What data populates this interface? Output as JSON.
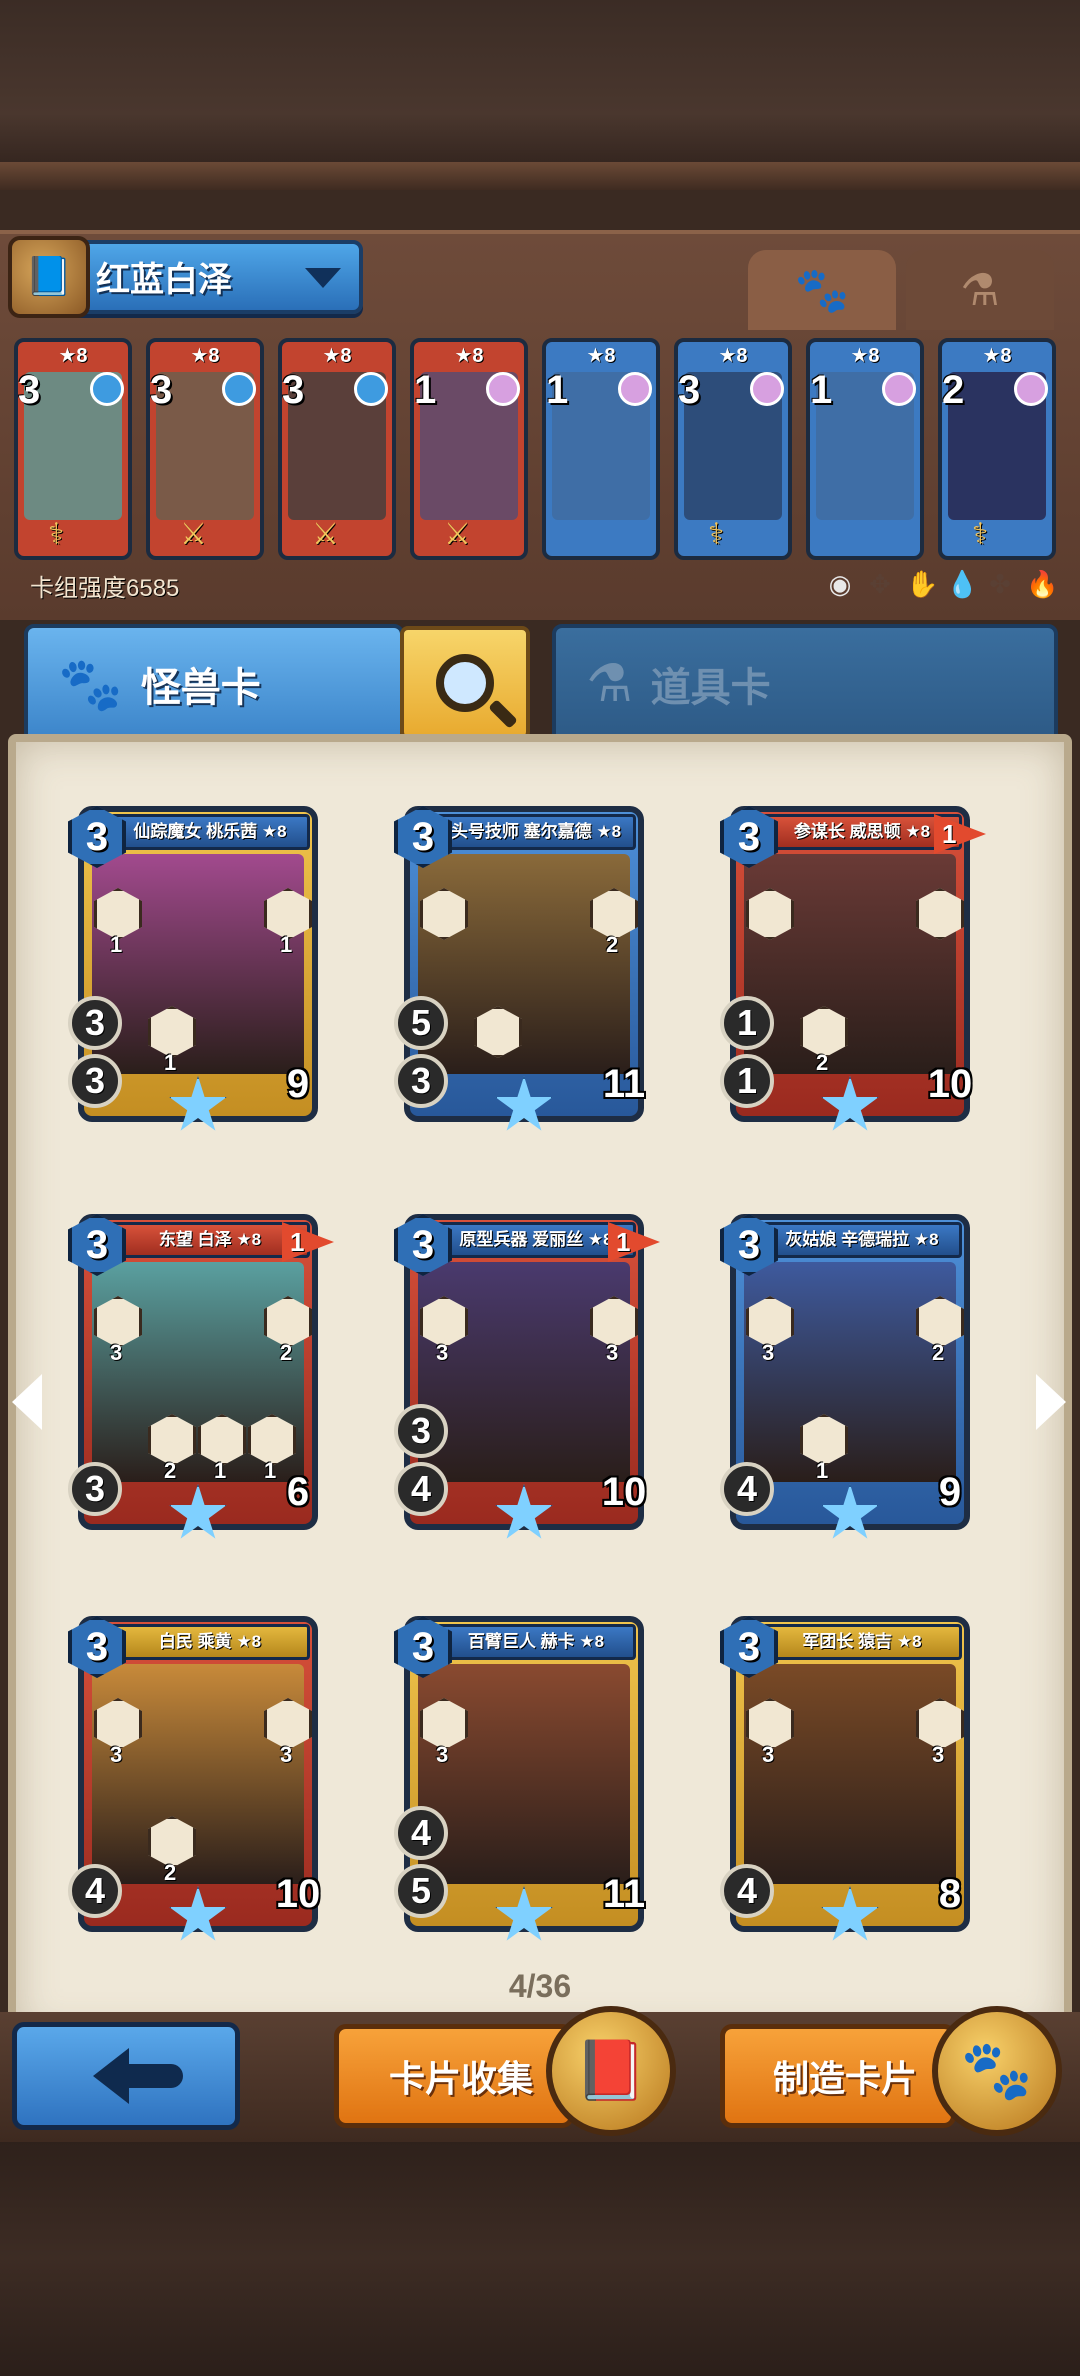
{
  "deck": {
    "name": "红蓝白泽",
    "strength_label": "卡组强度6585",
    "tabs": [
      {
        "icon": "paw-icon",
        "glyph": "🐾",
        "active": true
      },
      {
        "icon": "potion-icon",
        "glyph": "⚗",
        "active": false
      }
    ],
    "cards": [
      {
        "stars": "★8",
        "cost": "3",
        "frame": "#c2442f",
        "art": "#6d8a82",
        "gem": "#3e9be0",
        "tool": "⚕"
      },
      {
        "stars": "★8",
        "cost": "3",
        "frame": "#c2442f",
        "art": "#7a5a48",
        "gem": "#3e9be0",
        "tool": "⚔"
      },
      {
        "stars": "★8",
        "cost": "3",
        "frame": "#c2442f",
        "art": "#5a3f3a",
        "gem": "#3e9be0",
        "tool": "⚔"
      },
      {
        "stars": "★8",
        "cost": "1",
        "frame": "#c2442f",
        "art": "#6a4a66",
        "gem": "#d7a0e0",
        "tool": "⚔"
      },
      {
        "stars": "★8",
        "cost": "1",
        "frame": "#3c7ac2",
        "art": "#3f6ea6",
        "gem": "#d7a0e0",
        "tool": ""
      },
      {
        "stars": "★8",
        "cost": "3",
        "frame": "#3c7ac2",
        "art": "#2d4d7a",
        "gem": "#d7a0e0",
        "tool": "⚕"
      },
      {
        "stars": "★8",
        "cost": "1",
        "frame": "#3c7ac2",
        "art": "#3f6ea6",
        "gem": "#d7a0e0",
        "tool": ""
      },
      {
        "stars": "★8",
        "cost": "2",
        "frame": "#3c7ac2",
        "art": "#2a3360",
        "gem": "#d7a0e0",
        "tool": "⚕"
      }
    ],
    "elements": [
      {
        "icon": "neutral-element-icon",
        "glyph": "◉",
        "color": "#e8e8e8"
      },
      {
        "icon": "beast-element-icon",
        "glyph": "✥",
        "color": "#5a4034"
      },
      {
        "icon": "earth-element-icon",
        "glyph": "✋",
        "color": "#5a4034"
      },
      {
        "icon": "water-element-icon",
        "glyph": "💧",
        "color": "#3fa6ea"
      },
      {
        "icon": "wind-element-icon",
        "glyph": "✤",
        "color": "#5a4034"
      },
      {
        "icon": "fire-element-icon",
        "glyph": "🔥",
        "color": "#e8502a"
      }
    ]
  },
  "categories": {
    "monster_label": "怪兽卡",
    "item_label": "道具卡"
  },
  "page_indicator": "4/36",
  "cards": [
    {
      "name": "仙踪魔女 桃乐茜 ★8",
      "cost": "3",
      "atk": "3",
      "spd": "3",
      "hp": "9",
      "frame": "gold",
      "banner": "blue",
      "flag": "",
      "art": "#a24a8e",
      "skill_nums": [
        "1",
        "1",
        "1"
      ]
    },
    {
      "name": "头号技师 塞尔嘉德 ★8",
      "cost": "3",
      "atk": "3",
      "spd": "5",
      "hp": "11",
      "frame": "blue",
      "banner": "blue",
      "flag": "",
      "art": "#8a6a3a",
      "skill_nums": [
        "",
        "2",
        ""
      ]
    },
    {
      "name": "参谋长 威思顿 ★8",
      "cost": "3",
      "atk": "1",
      "spd": "1",
      "hp": "10",
      "frame": "red",
      "banner": "red",
      "flag": "1",
      "art": "#6a3a36",
      "skill_nums": [
        "",
        "",
        "2"
      ]
    },
    {
      "name": "东望 白泽 ★8",
      "cost": "3",
      "atk": "3",
      "spd": "",
      "hp": "6",
      "frame": "red",
      "banner": "red",
      "flag": "1",
      "art": "#5aa0a0",
      "skill_nums": [
        "3",
        "2",
        "2",
        "1",
        "1"
      ]
    },
    {
      "name": "原型兵器 爱丽丝 ★8",
      "cost": "3",
      "atk": "4",
      "spd": "3",
      "hp": "10",
      "frame": "red",
      "banner": "blue",
      "flag": "1",
      "art": "#4a3a6e",
      "skill_nums": [
        "3",
        "3"
      ]
    },
    {
      "name": "灰姑娘 辛德瑞拉 ★8",
      "cost": "3",
      "atk": "4",
      "spd": "",
      "hp": "9",
      "frame": "blue",
      "banner": "blue",
      "flag": "",
      "art": "#3e5a9e",
      "skill_nums": [
        "3",
        "2",
        "1"
      ]
    },
    {
      "name": "白民 乘黄 ★8",
      "cost": "3",
      "atk": "4",
      "spd": "",
      "hp": "10",
      "frame": "red",
      "banner": "goldb",
      "flag": "",
      "art": "#c88a3a",
      "skill_nums": [
        "3",
        "3",
        "2"
      ]
    },
    {
      "name": "百臂巨人 赫卡 ★8",
      "cost": "3",
      "atk": "5",
      "spd": "4",
      "hp": "11",
      "frame": "gold",
      "banner": "blue",
      "flag": "",
      "art": "#8a4a30",
      "skill_nums": [
        "3"
      ]
    },
    {
      "name": "军团长 猿吉 ★8",
      "cost": "3",
      "atk": "4",
      "spd": "",
      "hp": "8",
      "frame": "gold",
      "banner": "goldb",
      "flag": "",
      "art": "#7a4a26",
      "skill_nums": [
        "3",
        "3"
      ]
    }
  ],
  "buttons": {
    "back_icon": "back-arrow-icon",
    "collect_label": "卡片收集",
    "craft_label": "制造卡片",
    "collect_icon": "card-book-icon",
    "collect_glyph": "📕",
    "craft_icon": "paw-jar-icon",
    "craft_glyph": "🐾"
  }
}
